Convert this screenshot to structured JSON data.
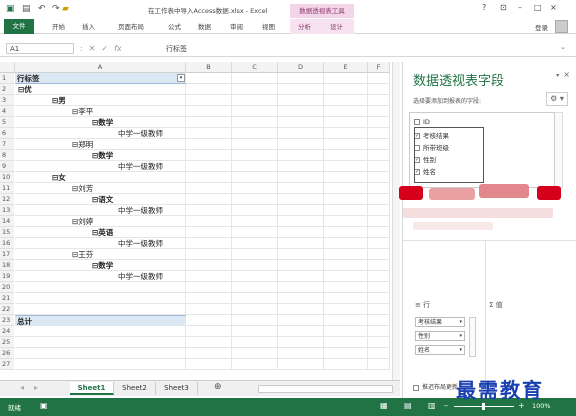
{
  "window": {
    "title": "在工作表中导入Access数据.xlsx - Excel",
    "context_title": "数据透视表工具",
    "help": "?",
    "minimize": "–",
    "restore": "□",
    "close": "×",
    "user": "登录"
  },
  "ribbon_tabs": [
    {
      "label": "文件"
    },
    {
      "label": "开始"
    },
    {
      "label": "插入"
    },
    {
      "label": "页面布局"
    },
    {
      "label": "公式"
    },
    {
      "label": "数据"
    },
    {
      "label": "审阅"
    },
    {
      "label": "视图"
    },
    {
      "label": "分析"
    },
    {
      "label": "设计"
    }
  ],
  "formula_bar": {
    "name_box": "A1",
    "fx": "fx",
    "content": "行标签"
  },
  "columns": [
    "A",
    "B",
    "C",
    "D",
    "E",
    "F"
  ],
  "rows": [
    "1",
    "2",
    "3",
    "4",
    "5",
    "6",
    "7",
    "8",
    "9",
    "10",
    "11",
    "12",
    "13",
    "14",
    "15",
    "16",
    "17",
    "18",
    "19",
    "20",
    "21",
    "22",
    "23",
    "24",
    "25",
    "26",
    "27"
  ],
  "pivot": {
    "header": "行标签",
    "filter_arrow": "▾",
    "items": [
      {
        "text": "⊟优",
        "indent": 0,
        "bold": true
      },
      {
        "text": "⊟男",
        "indent": 1,
        "bold": true
      },
      {
        "text": "⊟李平",
        "indent": 2,
        "bold": false
      },
      {
        "text": "⊟数学",
        "indent": 3,
        "bold": true
      },
      {
        "text": "中学一级教师",
        "indent": 4,
        "bold": false
      },
      {
        "text": "⊟郑明",
        "indent": 2,
        "bold": false
      },
      {
        "text": "⊟数学",
        "indent": 3,
        "bold": true
      },
      {
        "text": "中学一级教师",
        "indent": 4,
        "bold": false
      },
      {
        "text": "⊟女",
        "indent": 1,
        "bold": true
      },
      {
        "text": "⊟刘芳",
        "indent": 2,
        "bold": false
      },
      {
        "text": "⊟语文",
        "indent": 3,
        "bold": true
      },
      {
        "text": "中学一级教师",
        "indent": 4,
        "bold": false
      },
      {
        "text": "⊟刘婷",
        "indent": 2,
        "bold": false
      },
      {
        "text": "⊟英语",
        "indent": 3,
        "bold": true
      },
      {
        "text": "中学一级教师",
        "indent": 4,
        "bold": false
      },
      {
        "text": "⊟王芬",
        "indent": 2,
        "bold": false
      },
      {
        "text": "⊟数学",
        "indent": 3,
        "bold": true
      },
      {
        "text": "中学一级教师",
        "indent": 4,
        "bold": false
      }
    ],
    "total": "总计"
  },
  "sheets": [
    {
      "label": "Sheet1",
      "active": true
    },
    {
      "label": "Sheet2",
      "active": false
    },
    {
      "label": "Sheet3",
      "active": false
    }
  ],
  "sheet_add": "⊕",
  "status": {
    "ready": "就绪",
    "zoom": "100%"
  },
  "panel": {
    "title": "数据透视表字段",
    "close": "×",
    "subtitle": "选择要添加到报表的字段:",
    "gear": "⚙",
    "fields": [
      {
        "label": "ID",
        "checked": false
      },
      {
        "label": "考核结果",
        "checked": true
      },
      {
        "label": "所带班级",
        "checked": false
      },
      {
        "label": "性别",
        "checked": true
      },
      {
        "label": "姓名",
        "checked": true
      }
    ],
    "rows_label": "≡ 行",
    "values_label": "Σ 值",
    "row_fields": [
      "考核结果",
      "性别",
      "姓名"
    ],
    "defer_label": "推迟布局更新"
  },
  "watermark": "最需教育"
}
